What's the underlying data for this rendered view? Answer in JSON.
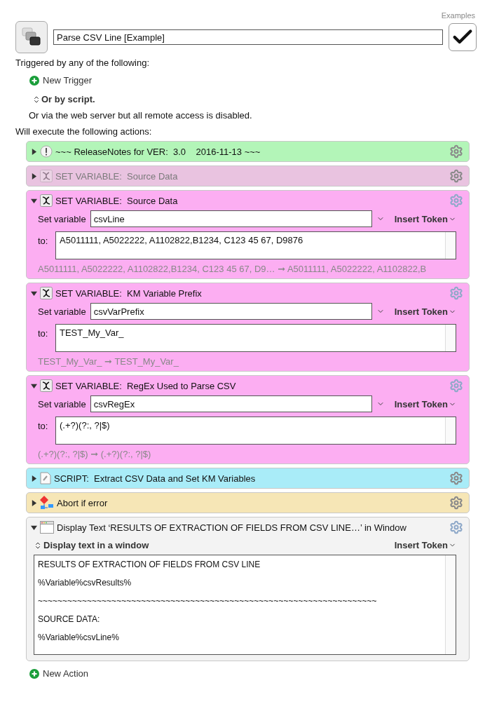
{
  "macro": {
    "group_label": "Examples",
    "name": "Parse CSV Line [Example]",
    "enabled": true
  },
  "triggers": {
    "heading": "Triggered by any of the following:",
    "new_trigger": "New Trigger",
    "script_option": "Or by script.",
    "web_note": "Or via the web server but all remote access is disabled."
  },
  "actions_heading": "Will execute the following actions:",
  "actions": [
    {
      "kind": "note",
      "title": "~~~ ReleaseNotes for VER:  3.0    2016-11-13 ~~~",
      "color": "#b3f5b8",
      "expanded": false,
      "disabled": false
    },
    {
      "kind": "variable",
      "title": "SET VARIABLE:  Source Data",
      "color": "#e9c3e0",
      "expanded": false,
      "disabled": true
    },
    {
      "kind": "variable",
      "title": "SET VARIABLE:  Source Data",
      "color": "#fcaef2",
      "expanded": true,
      "disabled": false,
      "set_label": "Set variable",
      "variable": "csvLine",
      "insert_token": "Insert Token",
      "to_label": "to:",
      "value": "A5011111, A5022222, A1102822,B1234, C123 45 67, D9876",
      "preview": "A5011111, A5022222, A1102822,B1234, C123 45 67, D9… ➞ A5011111, A5022222, A1102822,B"
    },
    {
      "kind": "variable",
      "title": "SET VARIABLE:  KM Variable Prefix",
      "color": "#fcaef2",
      "expanded": true,
      "disabled": false,
      "set_label": "Set variable",
      "variable": "csvVarPrefix",
      "insert_token": "Insert Token",
      "to_label": "to:",
      "value": "TEST_My_Var_",
      "preview": "TEST_My_Var_ ➞ TEST_My_Var_"
    },
    {
      "kind": "variable",
      "title": "SET VARIABLE:  RegEx Used to Parse CSV",
      "color": "#fcaef2",
      "expanded": true,
      "disabled": false,
      "set_label": "Set variable",
      "variable": "csvRegEx",
      "insert_token": "Insert Token",
      "to_label": "to:",
      "value": "(.+?)(?:, ?|$)",
      "preview": "(.+?)(?:, ?|$) ➞ (.+?)(?:, ?|$)"
    },
    {
      "kind": "script",
      "title": "SCRIPT:  Extract CSV Data and Set KM Variables",
      "color": "#a9ecf8",
      "expanded": false,
      "disabled": false
    },
    {
      "kind": "abort",
      "title": "Abort if error",
      "color": "#f6e6b6",
      "expanded": false,
      "disabled": false
    },
    {
      "kind": "display",
      "title": "Display Text ‘RESULTS OF EXTRACTION OF FIELDS FROM CSV LINE…’ in Window",
      "color": "#f3f3f3",
      "expanded": true,
      "disabled": false,
      "mode": "Display text in a window",
      "insert_token": "Insert Token",
      "lines": [
        "RESULTS OF EXTRACTION OF FIELDS FROM CSV LINE",
        "%Variable%csvResults%",
        "~~~~~~~~~~~~~~~~~~~~~~~~~~~~~~~~~~~~~~~~~~~~~~~~~~~~~~~~~~~~~~~~~~~~~",
        "SOURCE DATA:",
        "%Variable%csvLine%"
      ]
    }
  ],
  "new_action": "New Action"
}
